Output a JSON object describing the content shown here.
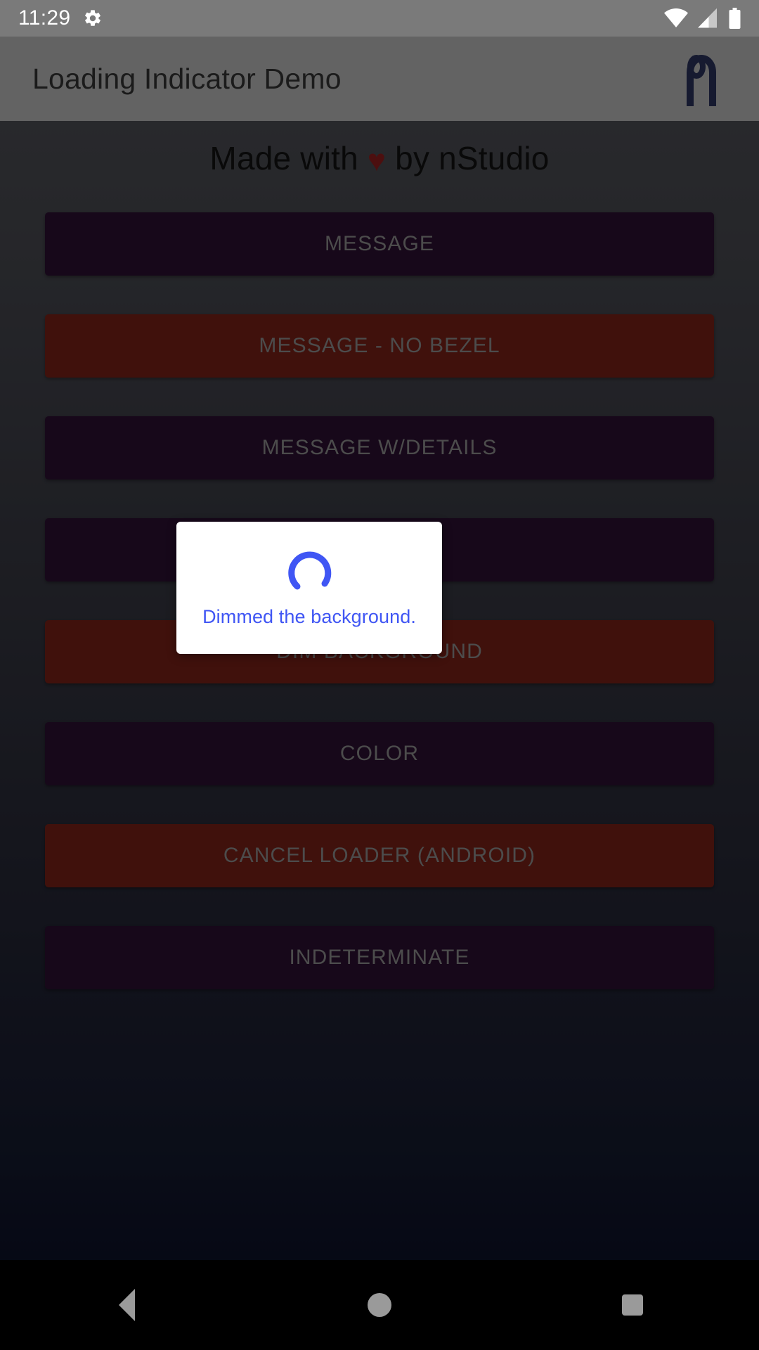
{
  "status_bar": {
    "time": "11:29",
    "icons": [
      "gear-icon",
      "wifi-icon",
      "cell-signal-icon",
      "battery-icon"
    ]
  },
  "action_bar": {
    "title": "Loading Indicator Demo",
    "logo": "nstudio-logo-icon"
  },
  "content": {
    "headline_prefix": "Made with",
    "headline_heart": "♥",
    "headline_suffix": "by nStudio",
    "buttons": [
      {
        "label": "MESSAGE",
        "variant": "purple"
      },
      {
        "label": "MESSAGE - NO BEZEL",
        "variant": "red"
      },
      {
        "label": "MESSAGE W/DETAILS",
        "variant": "purple"
      },
      {
        "label": "",
        "variant": "purple"
      },
      {
        "label": "DIM BACKGROUND",
        "variant": "red"
      },
      {
        "label": "COLOR",
        "variant": "purple"
      },
      {
        "label": "CANCEL LOADER (ANDROID)",
        "variant": "red"
      },
      {
        "label": "INDETERMINATE",
        "variant": "purple"
      }
    ]
  },
  "dialog": {
    "message": "Dimmed the background.",
    "spinner": "loading-spinner-icon",
    "accent_color": "#4056f4",
    "background_color": "#ffffff"
  },
  "nav_bar": {
    "back": "back-triangle-icon",
    "home": "home-circle-icon",
    "recent": "recent-apps-square-icon"
  },
  "colors": {
    "status_bar": "#7a7a7a",
    "action_bar": "#636363",
    "purple_button": "#2c1030",
    "red_button": "#772017",
    "accent_blue": "#4056f4"
  }
}
